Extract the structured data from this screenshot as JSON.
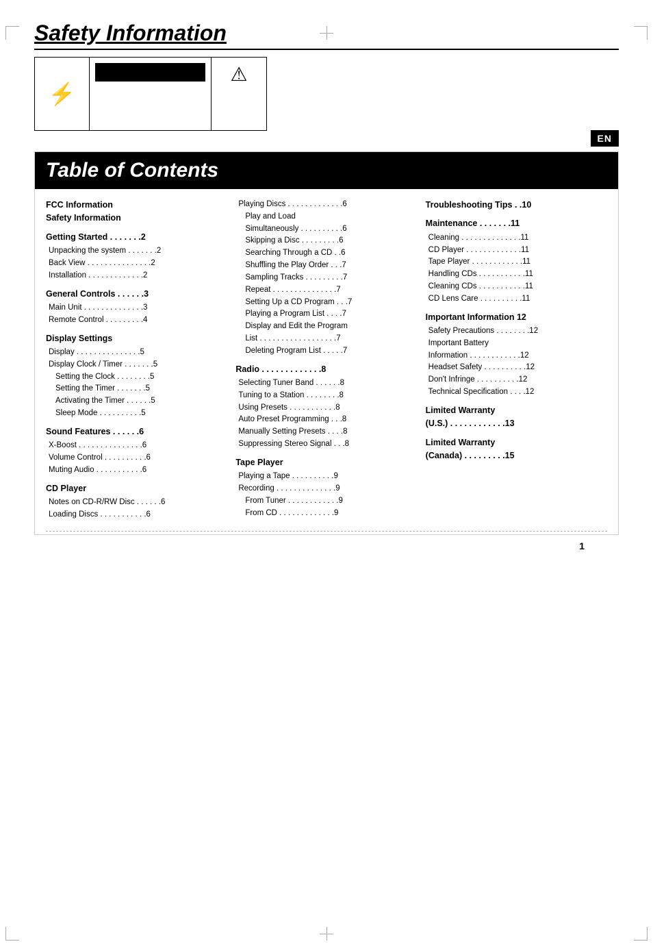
{
  "page": {
    "title": "Safety Information",
    "en_badge": "EN",
    "page_number": "1"
  },
  "warning_icons": {
    "lightning": "⚡",
    "caution": "⚠"
  },
  "toc": {
    "title": "Table of Contents",
    "col1": {
      "sections": [
        {
          "title": "FCC Information\nSafety Information",
          "items": []
        },
        {
          "title": "Getting Started . . . . . . .2",
          "items": [
            "Unpacking the system . . . . . . .2",
            "Back View . . . . . . . . . . . . . . .2",
            "Installation  . . . . . . . . . . . . .2"
          ]
        },
        {
          "title": "General Controls . . . . . .3",
          "items": [
            "Main Unit  . . . . . . . . . . . . . .3",
            "Remote Control  . . . . . . . . .4"
          ]
        },
        {
          "title": "Display Settings",
          "items": [
            "Display  . . . . . . . . . . . . . . .5",
            "Display Clock / Timer . . . . . . .5",
            "  Setting the Clock . . . . . . . .5",
            "  Setting the Timer  . . . . . . .5",
            "  Activating the Timer . . . . . .5",
            "  Sleep Mode  . . . . . . . . . .5"
          ]
        },
        {
          "title": "Sound Features . . . . . .6",
          "items": [
            "X-Boost  . . . . . . . . . . . . . . .6",
            "Volume Control . . . . . . . . . .6",
            "Muting Audio  . . . . . . . . . . .6"
          ]
        },
        {
          "title": "CD Player",
          "items": [
            "Notes on CD-R/RW Disc . . . . . .6",
            "Loading Discs  . . . . . . . . . . .6"
          ]
        }
      ]
    },
    "col2": {
      "sections": [
        {
          "title": "",
          "items": [
            "Playing Discs . . . . . . . . . . . . .6",
            "  Play and Load",
            "  Simultaneously . . . . . . . . . .6",
            "  Skipping a Disc  . . . . . . . . .6",
            "  Searching Through a CD  . .6",
            "  Shuffling the Play Order  . . .7",
            "  Sampling Tracks . . . . . . . . .7",
            "  Repeat  . . . . . . . . . . . . . . .7",
            "  Setting Up a CD Program . . .7",
            "  Playing a Program List  . . . .7",
            "  Display and Edit the Program",
            "  List . . . . . . . . . . . . . . . . . .7",
            "  Deleting Program List . . . . .7"
          ]
        },
        {
          "title": "Radio  . . . . . . . . . . . . .8",
          "items": [
            "Selecting Tuner Band  . . . . . .8",
            "Tuning to  a Station . . . . . . . .8",
            "Using Presets  . . . . . . . . . . .8",
            "Auto Preset Programming  . . .8",
            "Manually Setting Presets  . . . .8",
            "Suppressing Stereo Signal  . . .8"
          ]
        },
        {
          "title": "Tape Player",
          "items": [
            "Playing a Tape  . . . . . . . . . .9",
            "Recording . . . . . . . . . . . . . .9",
            "  From Tuner . . . . . . . . . . . .9",
            "  From CD  . . . . . . . . . . . . .9"
          ]
        }
      ]
    },
    "col3": {
      "sections": [
        {
          "title": "Troubleshooting Tips . .10",
          "items": []
        },
        {
          "title": "Maintenance  . . . . . . .11",
          "items": [
            "Cleaning  . . . . . . . . . . . . . .11",
            "CD Player  . . . . . . . . . . . . .11",
            "Tape Player . . . . . . . . . . . .11",
            "Handling CDs . . . . . . . . . . .11",
            "Cleaning CDs  . . . . . . . . . . .11",
            "CD Lens Care  . . . . . . . . . .11"
          ]
        },
        {
          "title": "Important Information 12",
          "items": [
            "Safety Precautions . . . . . . . .12",
            "Important Battery",
            "Information  . . . . . . . . . . . .12",
            "Headset Safety . . . . . . . . . .12",
            "Don't Infringe  . . . . . . . . . .12",
            "Technical Specification  . . . .12"
          ]
        },
        {
          "title": "Limited Warranty\n(U.S.)  . . . . . . . . . . . .13",
          "items": []
        },
        {
          "title": "Limited Warranty\n(Canada)  . . . . . . . . .15",
          "items": []
        }
      ]
    }
  }
}
